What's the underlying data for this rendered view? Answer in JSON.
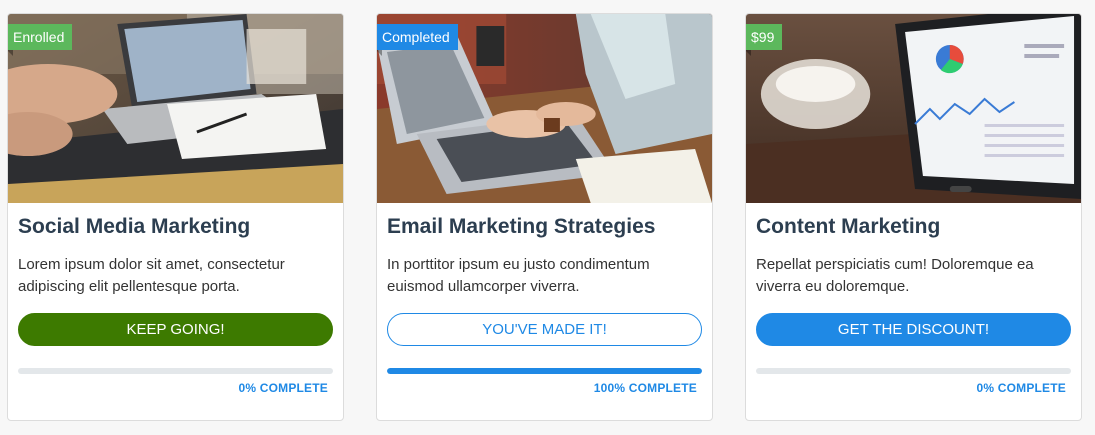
{
  "accent_color": "#1f89e5",
  "title_color": "#2c3e50",
  "courses": [
    {
      "badge": "Enrolled",
      "badge_color": "#5cb85c",
      "image": "laptop-notebook-photo",
      "title": "Social Media Marketing",
      "description": "Lorem ipsum dolor sit amet, consectetur adipiscing elit pellentesque porta.",
      "button_label": "KEEP GOING!",
      "button_style": "filled-green",
      "progress_percent": 0,
      "progress_label": "0% COMPLETE"
    },
    {
      "badge": "Completed",
      "badge_color": "#1f89e5",
      "image": "typing-laptop-photo",
      "title": "Email Marketing Strategies",
      "description": "In porttitor ipsum eu justo condimentum euismod ullamcorper viverra.",
      "button_label": "YOU'VE MADE IT!",
      "button_style": "outline-blue",
      "progress_percent": 100,
      "progress_label": "100% COMPLETE"
    },
    {
      "badge": "$99",
      "badge_color": "#5cb85c",
      "image": "tablet-analytics-photo",
      "title": "Content Marketing",
      "description": "Repellat perspiciatis cum! Doloremque ea viverra eu doloremque.",
      "button_label": "GET THE DISCOUNT!",
      "button_style": "filled-blue",
      "progress_percent": 0,
      "progress_label": "0% COMPLETE"
    }
  ]
}
